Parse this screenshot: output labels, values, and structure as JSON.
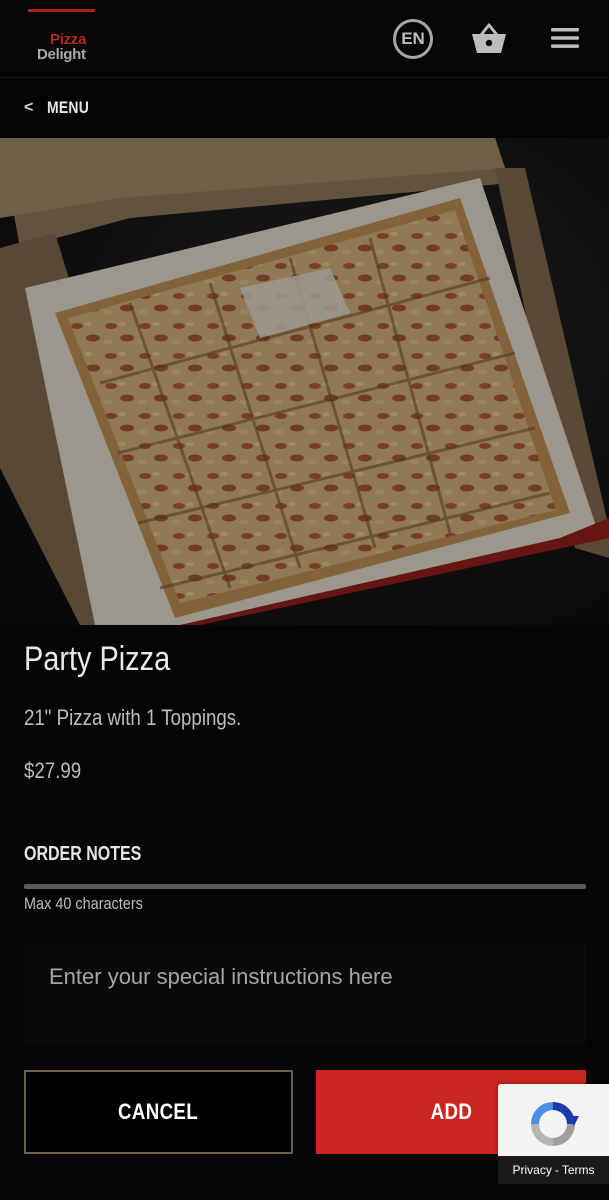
{
  "header": {
    "logo_line1": "Pizza",
    "logo_line2": "Delight",
    "language": "EN"
  },
  "nav": {
    "back_chevron": "<",
    "back_label": "MENU"
  },
  "product": {
    "name": "Party Pizza",
    "description": "21\" Pizza with 1 Toppings.",
    "price": "$27.99"
  },
  "order_notes": {
    "heading": "ORDER NOTES",
    "limit_text": "Max 40 characters",
    "placeholder": "Enter your special instructions here"
  },
  "actions": {
    "cancel_label": "CANCEL",
    "add_label": "ADD"
  },
  "recaptcha": {
    "privacy": "Privacy",
    "separator": "-",
    "terms": "Terms"
  },
  "icons": {
    "language": "globe-language-icon",
    "cart": "basket-icon",
    "menu": "hamburger-icon",
    "recaptcha": "recaptcha-icon"
  },
  "colors": {
    "brand_red": "#c8261e",
    "logo_red": "#b3261f",
    "background": "#050505",
    "cancel_border": "#6e5d48"
  }
}
